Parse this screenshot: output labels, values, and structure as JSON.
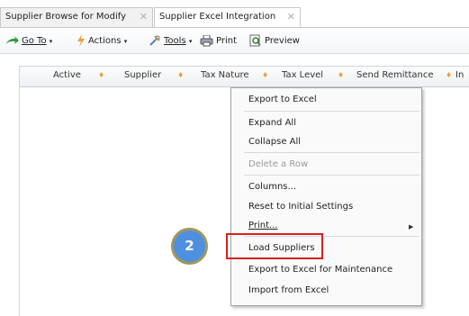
{
  "tabs": [
    {
      "label": "Supplier Browse for Modify",
      "close": "✕"
    },
    {
      "label": "Supplier Excel Integration",
      "close": "✕"
    }
  ],
  "toolbar": {
    "goto": "Go To",
    "actions": "Actions",
    "tools": "Tools",
    "print": "Print",
    "preview": "Preview"
  },
  "columns": [
    "Active",
    "Supplier",
    "Tax Nature",
    "Tax Level",
    "Send Remittance",
    "In"
  ],
  "context_menu": {
    "items": [
      {
        "label": "Export to Excel"
      },
      {
        "label": "Expand All"
      },
      {
        "label": "Collapse All"
      },
      {
        "label": "Delete a Row",
        "disabled": true
      },
      {
        "label": "Columns..."
      },
      {
        "label": "Reset to Initial Settings"
      },
      {
        "label": "Print...",
        "has_submenu": true
      },
      {
        "label": "Load Suppliers",
        "highlighted": true
      },
      {
        "label": "Export to Excel for Maintenance"
      },
      {
        "label": "Import from Excel"
      }
    ]
  },
  "step_badge": "2",
  "colors": {
    "highlight_border": "#d72020",
    "badge_fill": "#4f8fe0",
    "sort_icon": "#e8a13a"
  }
}
